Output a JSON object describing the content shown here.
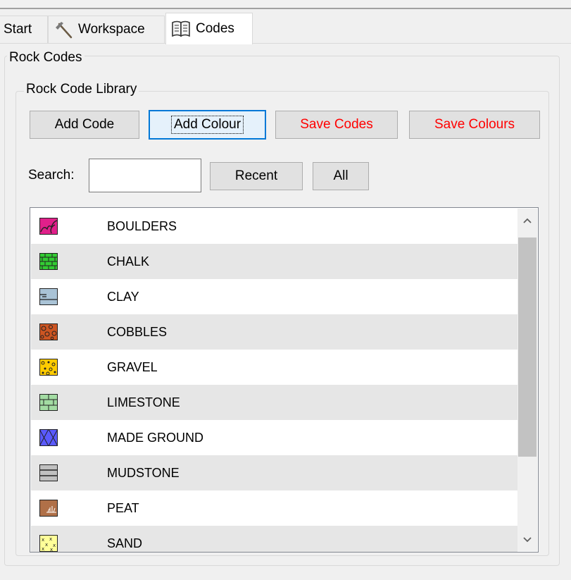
{
  "tabs": [
    {
      "label": "Start",
      "icon": "none",
      "active": false
    },
    {
      "label": "Workspace",
      "icon": "hammer-icon",
      "active": false
    },
    {
      "label": "Codes",
      "icon": "book-icon",
      "active": true
    }
  ],
  "rock_codes_title": "Rock Codes",
  "library_title": "Rock Code Library",
  "buttons": {
    "add_code": "Add Code",
    "add_colour": "Add Colour",
    "save_codes": "Save Codes",
    "save_colours": "Save Colours",
    "recent": "Recent",
    "all": "All"
  },
  "search": {
    "label": "Search:",
    "value": "",
    "placeholder": ""
  },
  "colors": {
    "accent_focus": "#0078d7",
    "save_text": "#ff0000"
  },
  "codes": [
    {
      "name": "BOULDERS",
      "icon": "boulders-pattern-icon",
      "color": "#e0208a"
    },
    {
      "name": "CHALK",
      "icon": "chalk-pattern-icon",
      "color": "#33cc33"
    },
    {
      "name": "CLAY",
      "icon": "clay-pattern-icon",
      "color": "#a9c3d6"
    },
    {
      "name": "COBBLES",
      "icon": "cobbles-pattern-icon",
      "color": "#cc5522"
    },
    {
      "name": "GRAVEL",
      "icon": "gravel-pattern-icon",
      "color": "#ffcc00"
    },
    {
      "name": "LIMESTONE",
      "icon": "limestone-pattern-icon",
      "color": "#a3dca3"
    },
    {
      "name": "MADE GROUND",
      "icon": "made-ground-pattern-icon",
      "color": "#5a5aff"
    },
    {
      "name": "MUDSTONE",
      "icon": "mudstone-pattern-icon",
      "color": "#c0c0c0"
    },
    {
      "name": "PEAT",
      "icon": "peat-pattern-icon",
      "color": "#b07048"
    },
    {
      "name": "SAND",
      "icon": "sand-pattern-icon",
      "color": "#ffff99"
    }
  ]
}
